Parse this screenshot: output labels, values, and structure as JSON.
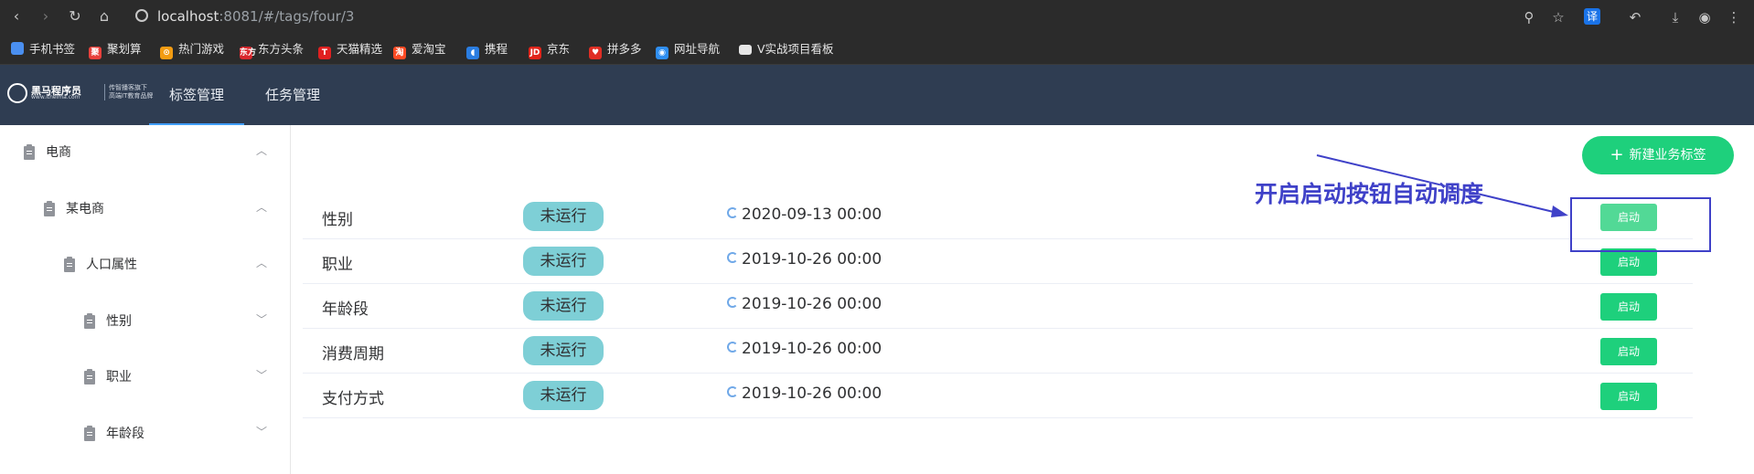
{
  "browser": {
    "url_host": "localhost",
    "url_path": ":8081/#/tags/four/3",
    "bookmarks": [
      {
        "label": "手机书签",
        "icon": "mobile-bookmark-icon",
        "color": "#4a8ff0",
        "glyph": ""
      },
      {
        "label": "聚划算",
        "icon": "juhuasuan-icon",
        "color": "#e8403b",
        "glyph": "聚"
      },
      {
        "label": "热门游戏",
        "icon": "game-icon",
        "color": "#f39c12",
        "glyph": "⊙"
      },
      {
        "label": "东方头条",
        "icon": "dongfang-icon",
        "color": "#d8272d",
        "glyph": "东方"
      },
      {
        "label": "天猫精选",
        "icon": "tmall-icon",
        "color": "#e02020",
        "glyph": "T"
      },
      {
        "label": "爱淘宝",
        "icon": "aitaobao-icon",
        "color": "#ff4b24",
        "glyph": "淘"
      },
      {
        "label": "携程",
        "icon": "ctrip-icon",
        "color": "#2a7de1",
        "glyph": "◖"
      },
      {
        "label": "京东",
        "icon": "jd-icon",
        "color": "#e1251b",
        "glyph": "JD"
      },
      {
        "label": "拼多多",
        "icon": "pinduoduo-icon",
        "color": "#e02e24",
        "glyph": "♥"
      },
      {
        "label": "网址导航",
        "icon": "nav-icon",
        "color": "#2f8ef0",
        "glyph": "◉"
      },
      {
        "label": "V实战项目看板",
        "icon": "folder-icon",
        "color": "#e6e6e6",
        "glyph": ""
      }
    ]
  },
  "header": {
    "logo": {
      "main": "黑马程序员",
      "sub": "www.itheima.com",
      "right_line1": "传智播客旗下",
      "right_line2": "高端IT教育品牌"
    },
    "tabs": [
      {
        "label": "标签管理",
        "active": true
      },
      {
        "label": "任务管理",
        "active": false
      }
    ]
  },
  "sidebar": {
    "items": [
      {
        "label": "电商",
        "level": 0,
        "expanded": true
      },
      {
        "label": "某电商",
        "level": 1,
        "expanded": true
      },
      {
        "label": "人口属性",
        "level": 2,
        "expanded": true
      },
      {
        "label": "性别",
        "level": 3,
        "expanded": false
      },
      {
        "label": "职业",
        "level": 3,
        "expanded": false
      },
      {
        "label": "年龄段",
        "level": 3,
        "expanded": false
      }
    ]
  },
  "main": {
    "add_button": "新建业务标签",
    "rows": [
      {
        "name": "性别",
        "status": "未运行",
        "time": "2020-09-13 00:00",
        "action": "启动"
      },
      {
        "name": "职业",
        "status": "未运行",
        "time": "2019-10-26 00:00",
        "action": "启动"
      },
      {
        "name": "年龄段",
        "status": "未运行",
        "time": "2019-10-26 00:00",
        "action": "启动"
      },
      {
        "name": "消费周期",
        "status": "未运行",
        "time": "2019-10-26 00:00",
        "action": "启动"
      },
      {
        "name": "支付方式",
        "status": "未运行",
        "time": "2019-10-26 00:00",
        "action": "启动"
      }
    ]
  },
  "annotation": {
    "text": "开启启动按钮自动调度",
    "color": "#3f41c8"
  },
  "colors": {
    "header_bg": "#2f3d52",
    "accent_green": "#1ed07c",
    "status_bg": "#7ecfd6"
  }
}
